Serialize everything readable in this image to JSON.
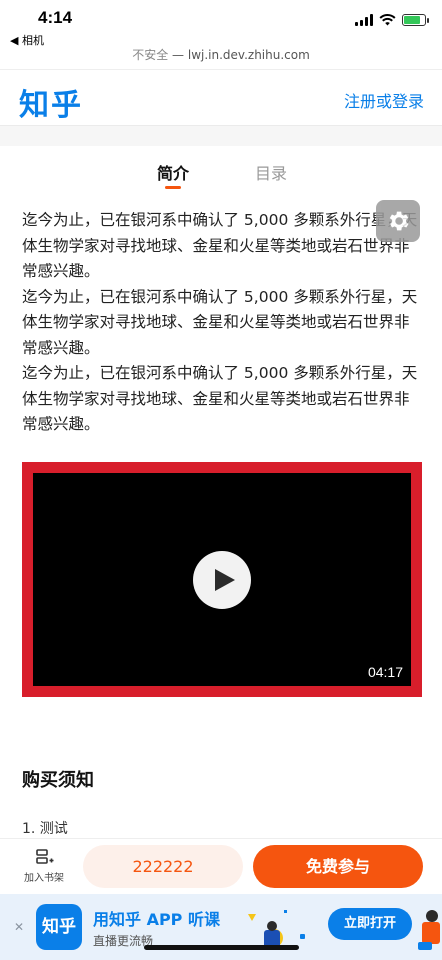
{
  "status_bar": {
    "time": "4:14",
    "back_app": "◀ 相机",
    "battery_level": 0.8
  },
  "url_bar": {
    "insecure_label": "不安全",
    "separator": " — ",
    "host": "lwj.in.dev.zhihu.com"
  },
  "header": {
    "logo": "知乎",
    "login_label": "注册或登录"
  },
  "tabs": [
    {
      "label": "简介",
      "active": true
    },
    {
      "label": "目录",
      "active": false
    }
  ],
  "content": {
    "paragraphs": [
      "迄今为止，已在银河系中确认了 5,000 多颗系外行星，天体生物学家对寻找地球、金星和火星等类地或岩石世界非常感兴趣。",
      "迄今为止，已在银河系中确认了 5,000 多颗系外行星，天体生物学家对寻找地球、金星和火星等类地或岩石世界非常感兴趣。",
      "迄今为止，已在银河系中确认了 5,000 多颗系外行星，天体生物学家对寻找地球、金星和火星等类地或岩石世界非常感兴趣。"
    ]
  },
  "video": {
    "duration": "04:17",
    "border_color": "#d81e2b"
  },
  "notice": {
    "title": "购买须知",
    "items": [
      "1. 测试"
    ]
  },
  "action_bar": {
    "shelf_label": "加入书架",
    "price_label": "222222",
    "join_label": "免费参与"
  },
  "app_banner": {
    "close_glyph": "✕",
    "logo_text": "知乎",
    "title": "用知乎 APP 听课",
    "subtitle": "直播更流畅",
    "open_label": "立即打开"
  },
  "colors": {
    "brand_blue": "#0a7fe8",
    "accent_orange": "#f5550f"
  },
  "icons": [
    "signal-icon",
    "wifi-icon",
    "battery-icon",
    "settings-icon",
    "play-icon",
    "bookshelf-icon",
    "close-icon"
  ]
}
